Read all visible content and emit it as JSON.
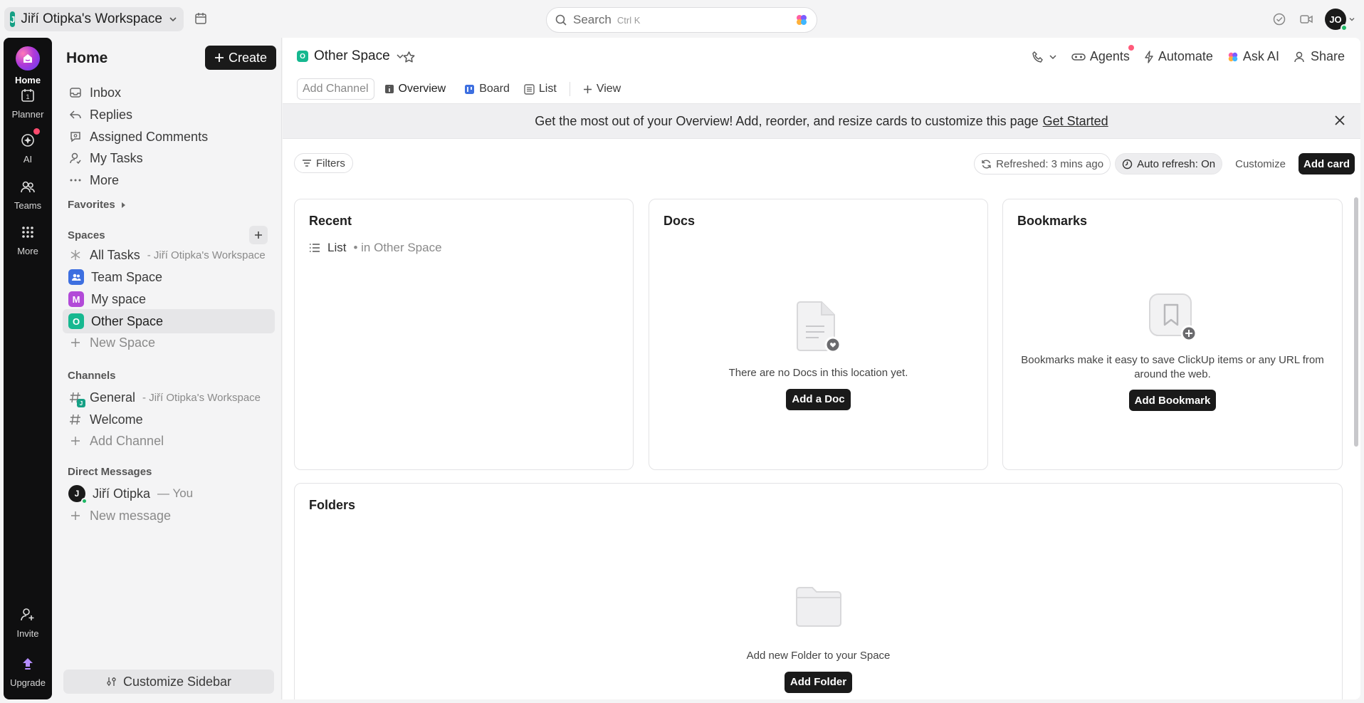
{
  "topbar": {
    "workspace_initial": "J",
    "workspace_name": "Jiří Otipka's Workspace",
    "search_placeholder": "Search",
    "search_shortcut": "Ctrl K",
    "user_initials": "JO"
  },
  "rail": {
    "items": [
      {
        "label": "Home",
        "icon": "home-icon"
      },
      {
        "label": "Planner",
        "icon": "calendar-icon"
      },
      {
        "label": "AI",
        "icon": "ai-icon"
      },
      {
        "label": "Teams",
        "icon": "teams-icon"
      },
      {
        "label": "More",
        "icon": "grid-icon"
      },
      {
        "label": "Invite",
        "icon": "invite-icon"
      },
      {
        "label": "Upgrade",
        "icon": "upgrade-icon"
      }
    ],
    "planner_day": "1"
  },
  "sidebar": {
    "title": "Home",
    "create_label": "Create",
    "nav": [
      {
        "label": "Inbox",
        "icon": "inbox-icon"
      },
      {
        "label": "Replies",
        "icon": "reply-icon"
      },
      {
        "label": "Assigned Comments",
        "icon": "comment-icon"
      },
      {
        "label": "My Tasks",
        "icon": "user-task-icon"
      },
      {
        "label": "More",
        "icon": "ellipsis-icon"
      }
    ],
    "favorites_label": "Favorites",
    "spaces_label": "Spaces",
    "spaces": [
      {
        "label": "All Tasks",
        "sub": "- Jiří Otipka's Workspace",
        "initial": "",
        "color": ""
      },
      {
        "label": "Team Space",
        "sub": "",
        "initial": "",
        "color": "#3d6fe0"
      },
      {
        "label": "My space",
        "sub": "",
        "initial": "M",
        "color": "#b24ad8"
      },
      {
        "label": "Other Space",
        "sub": "",
        "initial": "O",
        "color": "#16b890"
      }
    ],
    "new_space_label": "New Space",
    "channels_label": "Channels",
    "channels": [
      {
        "label": "General",
        "sub": "- Jiří Otipka's Workspace"
      },
      {
        "label": "Welcome",
        "sub": ""
      }
    ],
    "add_channel_label": "Add Channel",
    "dm_label": "Direct Messages",
    "dm_user": "Jiří Otipka",
    "dm_you": "— You",
    "dm_initial": "J",
    "new_message_label": "New message",
    "customize_label": "Customize Sidebar"
  },
  "main": {
    "space_initial": "O",
    "space_name": "Other Space",
    "actions": {
      "agents": "Agents",
      "automate": "Automate",
      "ask_ai": "Ask AI",
      "share": "Share"
    },
    "tabs": {
      "add_channel": "Add Channel",
      "overview": "Overview",
      "board": "Board",
      "list": "List",
      "view": "View"
    },
    "banner": {
      "text": "Get the most out of your Overview! Add, reorder, and resize cards to customize this page",
      "link": "Get Started"
    },
    "toolbar": {
      "filters": "Filters",
      "refreshed": "Refreshed: 3 mins ago",
      "auto_refresh": "Auto refresh: On",
      "customize": "Customize",
      "add_card": "Add card"
    },
    "cards": {
      "recent": {
        "title": "Recent",
        "item": "List",
        "item_location": "• in Other Space"
      },
      "docs": {
        "title": "Docs",
        "empty": "There are no Docs in this location yet.",
        "button": "Add a Doc"
      },
      "bookmarks": {
        "title": "Bookmarks",
        "empty": "Bookmarks make it easy to save ClickUp items or any URL from around the web.",
        "button": "Add Bookmark"
      },
      "folders": {
        "title": "Folders",
        "empty": "Add new Folder to your Space",
        "button": "Add Folder"
      }
    }
  },
  "colors": {
    "accent_dark": "#1a1a1a",
    "space_green": "#16b890",
    "notification": "#ff4b6e"
  }
}
